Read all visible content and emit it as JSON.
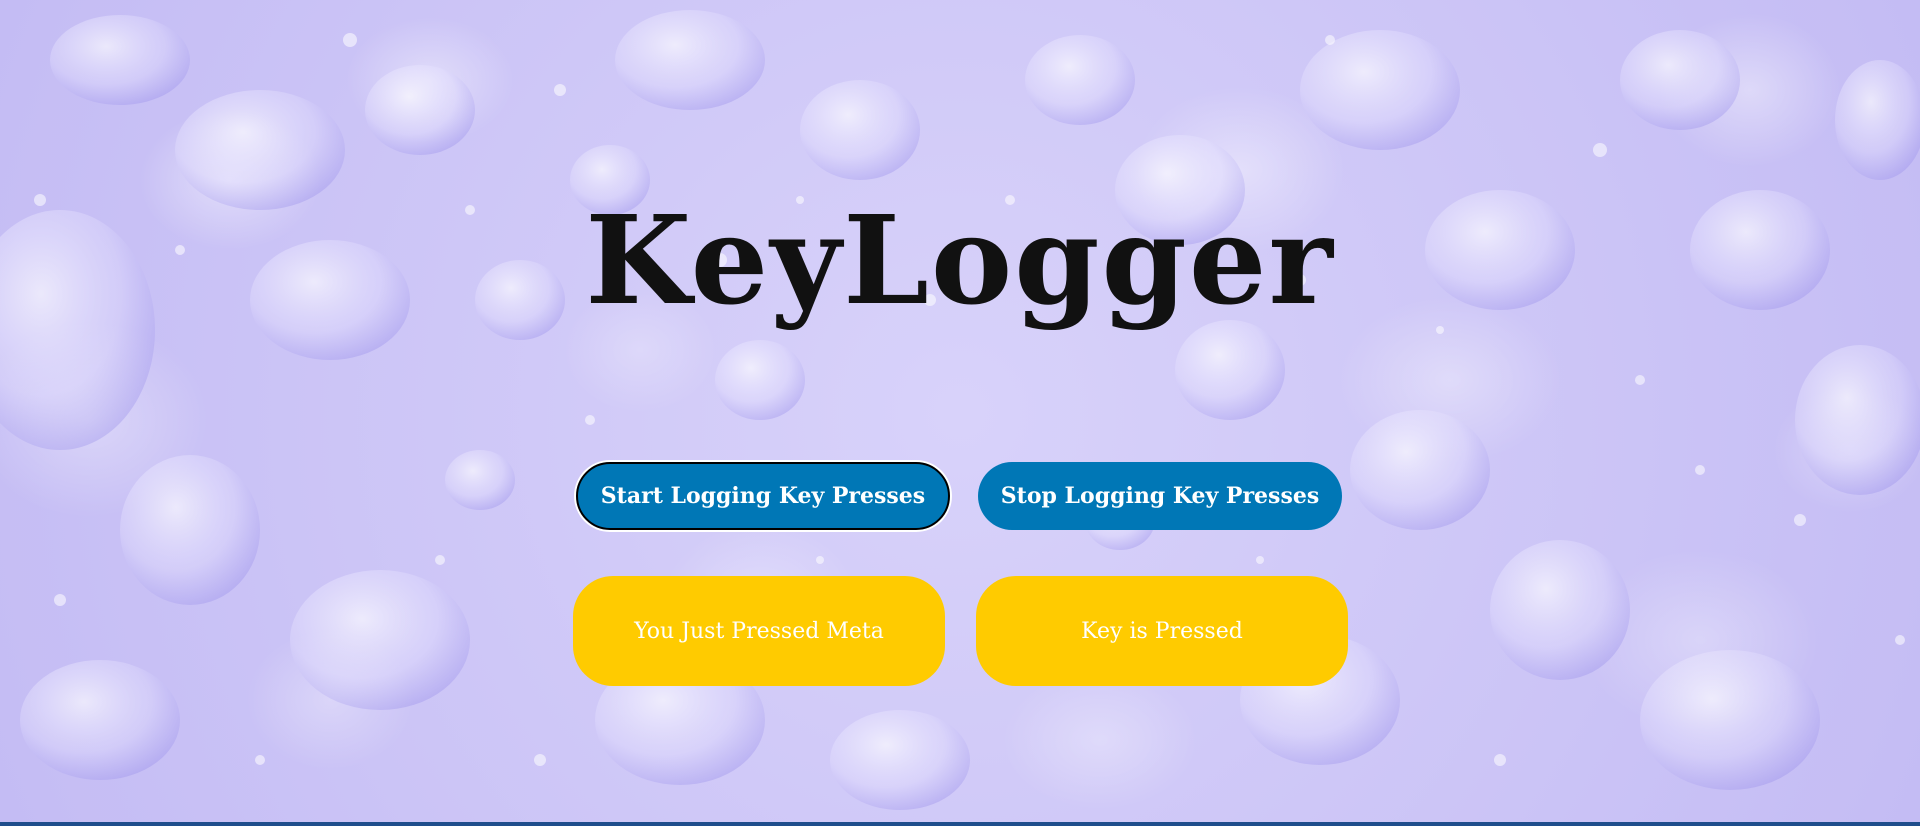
{
  "app": {
    "title": "KeyLogger"
  },
  "controls": {
    "start_label": "Start Logging Key Presses",
    "stop_label": "Stop Logging Key Presses"
  },
  "display": {
    "last_key_label": "You Just Pressed Meta",
    "status_label": "Key is Pressed"
  },
  "colors": {
    "background": "#cdc6f7",
    "primary_button": "#0077b6",
    "display_box": "#ffcb00",
    "bottom_bar": "#1f4e8c",
    "title_text": "#111111"
  }
}
